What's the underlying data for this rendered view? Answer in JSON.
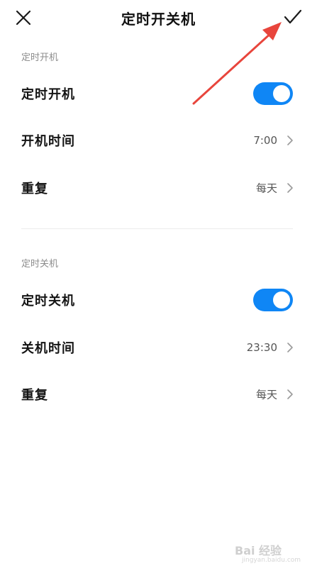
{
  "header": {
    "title": "定时开关机"
  },
  "power_on": {
    "section_label": "定时开机",
    "toggle_label": "定时开机",
    "toggle_on": true,
    "time_label": "开机时间",
    "time_value": "7:00",
    "repeat_label": "重复",
    "repeat_value": "每天"
  },
  "power_off": {
    "section_label": "定时关机",
    "toggle_label": "定时关机",
    "toggle_on": true,
    "time_label": "关机时间",
    "time_value": "23:30",
    "repeat_label": "重复",
    "repeat_value": "每天"
  },
  "colors": {
    "accent": "#0f86f5",
    "annotation": "#e8453c"
  },
  "icons": {
    "close": "close-icon",
    "confirm": "checkmark-icon",
    "chevron": "chevron-right-icon"
  },
  "watermark": {
    "brand": "Bai 经验",
    "url": "jingyan.baidu.com"
  }
}
